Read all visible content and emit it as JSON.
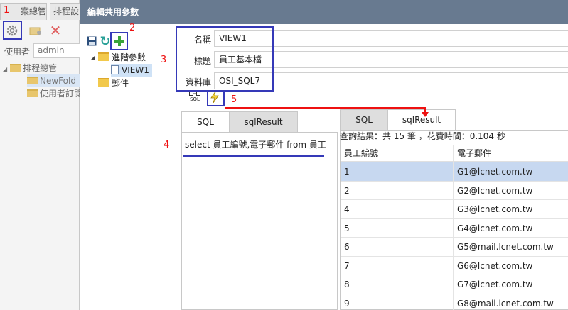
{
  "background": {
    "tabs": [
      "案總管",
      "排程設"
    ],
    "user_label": "使用者",
    "user_value": "admin",
    "tree": {
      "root": "排程總管",
      "items": [
        "NewFold",
        "使用者訂閱"
      ]
    }
  },
  "dialog": {
    "title": "編輯共用參數",
    "tree": {
      "root": "進階參數",
      "child": "VIEW1",
      "sibling": "郵件"
    },
    "form": {
      "name_label": "名稱",
      "name_value": "VIEW1",
      "title_label": "標題",
      "title_value": "員工基本檔",
      "db_label": "資料庫",
      "db_value": "OSI_SQL7"
    },
    "sql_icon_label": "SQL",
    "left_tabs": [
      "SQL",
      "sqlResult"
    ],
    "sql_text": "select 員工編號,電子郵件 from 員工",
    "right_tabs": [
      "SQL",
      "sqlResult"
    ],
    "result_summary": "查詢結果：共 15 筆 ，花費時間：0.104 秒",
    "grid": {
      "columns": [
        "員工編號",
        "電子郵件"
      ],
      "rows": [
        [
          "1",
          "G1@lcnet.com.tw"
        ],
        [
          "2",
          "G2@lcnet.com.tw"
        ],
        [
          "4",
          "G3@lcnet.com.tw"
        ],
        [
          "5",
          "G4@lcnet.com.tw"
        ],
        [
          "6",
          "G5@mail.lcnet.com.tw"
        ],
        [
          "7",
          "G6@lcnet.com.tw"
        ],
        [
          "8",
          "G7@lcnet.com.tw"
        ],
        [
          "9",
          "G8@mail.lcnet.com.tw"
        ]
      ]
    }
  },
  "annotations": [
    "1",
    "2",
    "3",
    "4",
    "5"
  ],
  "colors": {
    "title_bar": "#687a90",
    "annotation_red": "#e11111",
    "annotation_blue": "#3539b8",
    "selected_row": "#c7d8f0"
  }
}
